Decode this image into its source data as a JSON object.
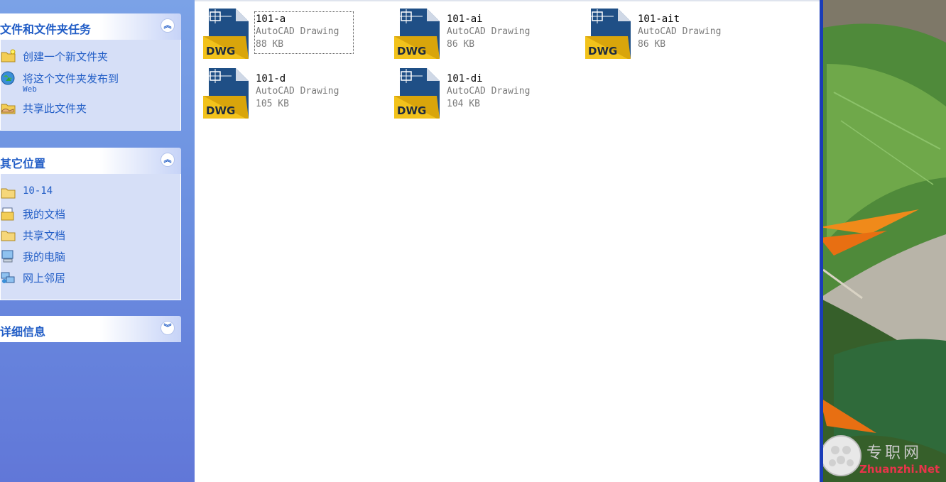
{
  "taskpane": {
    "file_tasks": {
      "title": "文件和文件夹任务",
      "items": [
        {
          "label": "创建一个新文件夹",
          "icon": "new-folder-icon"
        },
        {
          "label": "将这个文件夹发布到",
          "sub": "Web",
          "icon": "publish-web-icon"
        },
        {
          "label": "共享此文件夹",
          "icon": "share-folder-icon"
        }
      ]
    },
    "other_places": {
      "title": "其它位置",
      "items": [
        {
          "label": "10-14",
          "icon": "folder-icon"
        },
        {
          "label": "我的文档",
          "icon": "my-documents-icon"
        },
        {
          "label": "共享文档",
          "icon": "shared-folder-icon"
        },
        {
          "label": "我的电脑",
          "icon": "my-computer-icon"
        },
        {
          "label": "网上邻居",
          "icon": "network-places-icon"
        }
      ]
    },
    "details": {
      "title": "详细信息"
    }
  },
  "files": [
    {
      "name": "101-a",
      "type": "AutoCAD Drawing",
      "size": "88 KB",
      "selected": true
    },
    {
      "name": "101-ai",
      "type": "AutoCAD Drawing",
      "size": "86 KB"
    },
    {
      "name": "101-ait",
      "type": "AutoCAD Drawing",
      "size": "86 KB"
    },
    {
      "name": "101-d",
      "type": "AutoCAD Drawing",
      "size": "105 KB"
    },
    {
      "name": "101-di",
      "type": "AutoCAD Drawing",
      "size": "104 KB"
    }
  ],
  "dwg_label": "DWG",
  "watermark": {
    "cn": "专职网",
    "en": "Zhuanzhi.Net"
  },
  "colors": {
    "accent": "#215dc6",
    "pane": "#6b8fe0",
    "dwg_yellow": "#f2c21b",
    "dwg_blue": "#1f4f86"
  }
}
